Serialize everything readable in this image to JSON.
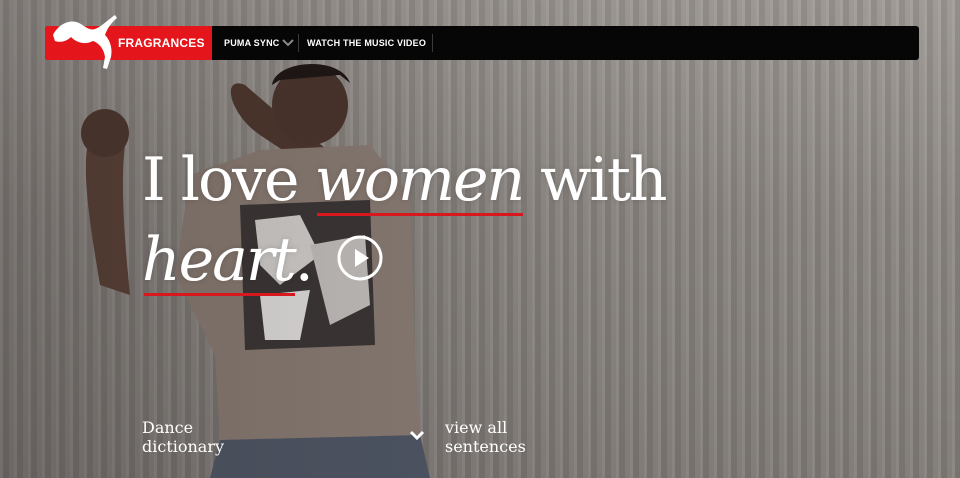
{
  "nav": {
    "brand": "FRAGRANCES",
    "items": [
      {
        "label": "PUMA SYNC",
        "has_dropdown": true
      },
      {
        "label": "WATCH THE MUSIC VIDEO",
        "has_dropdown": false
      }
    ]
  },
  "hero": {
    "headline": {
      "part1": "I love ",
      "part2": "women",
      "part3": " with",
      "part4": "heart",
      "part5": "."
    },
    "play_icon": "play-circle-icon"
  },
  "footer_links": {
    "dance_dictionary_line1": "Dance",
    "dance_dictionary_line2": "dictionary",
    "view_all_line1": "view all",
    "view_all_line2": "sentences"
  },
  "colors": {
    "brand_red": "#e4161b",
    "navbar_bg": "#060606",
    "underline_red": "#d7191f"
  }
}
